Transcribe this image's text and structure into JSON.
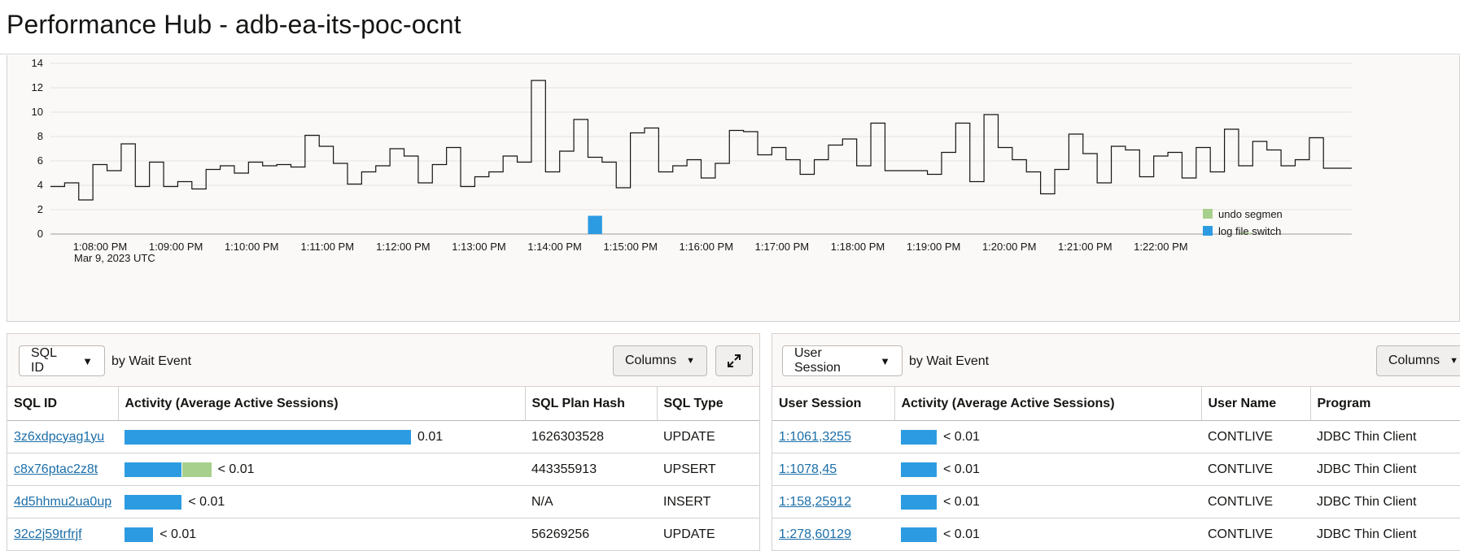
{
  "page": {
    "title": "Performance Hub - adb-ea-its-poc-ocnt"
  },
  "colors": {
    "log_file_switch": "#2d9be1",
    "undo_segment": "#a8d08d",
    "link": "#1b6ea8"
  },
  "chart_data": {
    "type": "line",
    "title": "",
    "xlabel": "",
    "ylabel": "",
    "ylim": [
      0,
      14
    ],
    "yticks": [
      "0",
      "2",
      "4",
      "6",
      "8",
      "10",
      "12",
      "14"
    ],
    "xticks": [
      "1:08:00 PM",
      "1:09:00 PM",
      "1:10:00 PM",
      "1:11:00 PM",
      "1:12:00 PM",
      "1:13:00 PM",
      "1:14:00 PM",
      "1:15:00 PM",
      "1:16:00 PM",
      "1:17:00 PM",
      "1:18:00 PM",
      "1:19:00 PM",
      "1:20:00 PM",
      "1:21:00 PM",
      "1:22:00 PM"
    ],
    "date_label": "Mar 9, 2023 UTC",
    "grid": true,
    "legend": [
      "undo segment extension",
      "log file switch (checkpoint incomplete)"
    ],
    "legend_display": [
      "undo segmen",
      "log file switch"
    ],
    "series": [
      {
        "name": "",
        "style": "step",
        "values": [
          3.9,
          4.2,
          2.8,
          5.7,
          5.2,
          7.4,
          3.9,
          5.9,
          3.9,
          4.3,
          3.7,
          5.3,
          5.6,
          5.0,
          5.9,
          5.6,
          5.7,
          5.5,
          8.1,
          7.2,
          5.8,
          4.1,
          5.1,
          5.6,
          7.0,
          6.4,
          4.2,
          5.7,
          7.1,
          3.9,
          4.7,
          5.1,
          6.4,
          5.9,
          12.6,
          5.1,
          6.8,
          9.4,
          6.3,
          5.9,
          3.8,
          8.3,
          8.7,
          5.1,
          5.6,
          6.1,
          4.6,
          5.8,
          8.5,
          8.4,
          6.5,
          7.1,
          6.1,
          4.9,
          6.1,
          7.3,
          7.8,
          5.6,
          9.1,
          5.2,
          5.2,
          5.2,
          4.9,
          6.7,
          9.1,
          4.3,
          9.8,
          7.1,
          6.1,
          5.1,
          3.3,
          5.3,
          8.2,
          6.6,
          4.2,
          7.2,
          6.9,
          4.7,
          6.4,
          6.7,
          4.6,
          7.1,
          5.1,
          8.6,
          5.6,
          7.6,
          6.9,
          5.6,
          6.1,
          7.9,
          5.4,
          5.4
        ]
      },
      {
        "name": "log file switch (checkpoint incomplete)",
        "style": "bar",
        "points": [
          {
            "index": 38,
            "value": 1.5
          }
        ]
      },
      {
        "name": "undo segment extension",
        "style": "bar",
        "points": [
          {
            "index": 84,
            "value": 0.1
          }
        ]
      }
    ]
  },
  "left": {
    "group_select": "SQL ID",
    "by_text": "by Wait Event",
    "columns_label": "Columns",
    "headers": [
      "SQL ID",
      "Activity (Average Active Sessions)",
      "SQL Plan Hash",
      "SQL Type"
    ],
    "rows": [
      {
        "id": "3z6xdpcyag1yu",
        "activity": "0.01",
        "blue": 1.0,
        "green": 0.0,
        "plan": "1626303528",
        "type": "UPDATE"
      },
      {
        "id": "c8x76ptac2z8t",
        "activity": "< 0.01",
        "blue": 0.2,
        "green": 0.1,
        "plan": "443355913",
        "type": "UPSERT"
      },
      {
        "id": "4d5hhmu2ua0up",
        "activity": "< 0.01",
        "blue": 0.2,
        "green": 0.0,
        "plan": "N/A",
        "type": "INSERT"
      },
      {
        "id": "32c2j59trfrjf",
        "activity": "< 0.01",
        "blue": 0.1,
        "green": 0.0,
        "plan": "56269256",
        "type": "UPDATE"
      }
    ]
  },
  "right": {
    "group_select": "User Session",
    "by_text": "by Wait Event",
    "columns_label": "Columns",
    "headers": [
      "User Session",
      "Activity (Average Active Sessions)",
      "User Name",
      "Program"
    ],
    "rows": [
      {
        "session": "1:1061,3255",
        "activity": "< 0.01",
        "blue": 1.0,
        "user": "CONTLIVE",
        "program": "JDBC Thin Client"
      },
      {
        "session": "1:1078,45",
        "activity": "< 0.01",
        "blue": 1.0,
        "user": "CONTLIVE",
        "program": "JDBC Thin Client"
      },
      {
        "session": "1:158,25912",
        "activity": "< 0.01",
        "blue": 1.0,
        "user": "CONTLIVE",
        "program": "JDBC Thin Client"
      },
      {
        "session": "1:278,60129",
        "activity": "< 0.01",
        "blue": 1.0,
        "user": "CONTLIVE",
        "program": "JDBC Thin Client"
      }
    ]
  }
}
